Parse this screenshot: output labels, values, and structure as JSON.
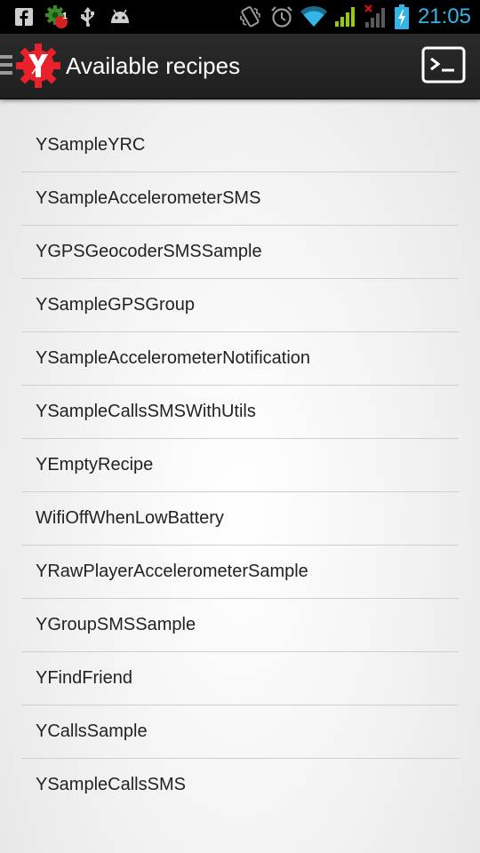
{
  "status_bar": {
    "time": "21:05",
    "notification_badge": "1",
    "icons": [
      "facebook-icon",
      "notification-badge-icon",
      "usb-icon",
      "android-debug-icon",
      "vibrate-icon",
      "alarm-icon",
      "wifi-icon",
      "signal-icon",
      "no-signal-icon",
      "battery-charging-icon"
    ],
    "accent_color": "#33b5e5",
    "signal_color": "#99cc00"
  },
  "action_bar": {
    "title": "Available recipes",
    "logo_letter": "Y",
    "logo_color": "#e8212b",
    "drawer_icon": "drawer-menu-icon",
    "action_icon": "terminal-icon"
  },
  "recipes": {
    "items": [
      {
        "label": "YSampleYRC"
      },
      {
        "label": "YSampleAccelerometerSMS"
      },
      {
        "label": "YGPSGeocoderSMSSample"
      },
      {
        "label": "YSampleGPSGroup"
      },
      {
        "label": "YSampleAccelerometerNotification"
      },
      {
        "label": "YSampleCallsSMSWithUtils"
      },
      {
        "label": "YEmptyRecipe"
      },
      {
        "label": "WifiOffWhenLowBattery"
      },
      {
        "label": "YRawPlayerAccelerometerSample"
      },
      {
        "label": "YGroupSMSSample"
      },
      {
        "label": "YFindFriend"
      },
      {
        "label": "YCallsSample"
      },
      {
        "label": "YSampleCallsSMS"
      }
    ]
  }
}
